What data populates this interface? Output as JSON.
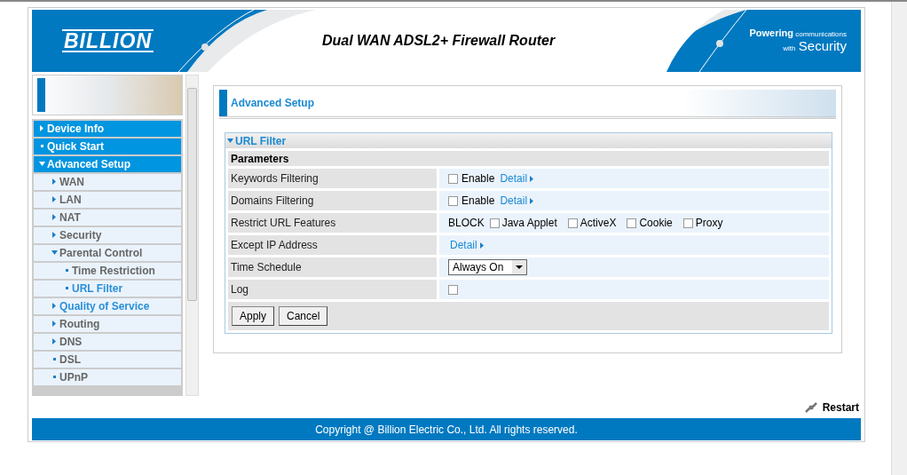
{
  "header": {
    "logo": "BILLION",
    "title": "Dual WAN ADSL2+ Firewall Router",
    "tagline_small": "Powering communications",
    "tagline_with": "with",
    "tagline_big": "Security"
  },
  "sidebar": {
    "items": [
      {
        "label": "Device Info",
        "kind": "folder",
        "expanded": false,
        "selected": false
      },
      {
        "label": "Quick Start",
        "kind": "page",
        "selected": false
      },
      {
        "label": "Advanced Setup",
        "kind": "folder",
        "expanded": true,
        "selected": false,
        "children": [
          {
            "label": "WAN",
            "kind": "folder",
            "expanded": false,
            "selected": false
          },
          {
            "label": "LAN",
            "kind": "folder",
            "expanded": false,
            "selected": false
          },
          {
            "label": "NAT",
            "kind": "folder",
            "expanded": false,
            "selected": false
          },
          {
            "label": "Security",
            "kind": "folder",
            "expanded": false,
            "selected": false
          },
          {
            "label": "Parental Control",
            "kind": "folder",
            "expanded": true,
            "selected": false,
            "children": [
              {
                "label": "Time Restriction",
                "kind": "page",
                "selected": false
              },
              {
                "label": "URL Filter",
                "kind": "page",
                "selected": true
              }
            ]
          },
          {
            "label": "Quality of Service",
            "kind": "folder",
            "expanded": false,
            "selected": true
          },
          {
            "label": "Routing",
            "kind": "folder",
            "expanded": false,
            "selected": false
          },
          {
            "label": "DNS",
            "kind": "folder",
            "expanded": false,
            "selected": false
          },
          {
            "label": "DSL",
            "kind": "page",
            "selected": false
          },
          {
            "label": "UPnP",
            "kind": "page",
            "selected": false
          }
        ]
      }
    ]
  },
  "content": {
    "title": "Advanced Setup",
    "section": {
      "title": "URL Filter",
      "expanded": true,
      "parameters_label": "Parameters",
      "rows": [
        {
          "label": "Keywords Filtering",
          "kind": "enable",
          "checked": false,
          "enable_label": "Enable",
          "link": "Detail"
        },
        {
          "label": "Domains Filtering",
          "kind": "enable",
          "checked": false,
          "enable_label": "Enable",
          "link": "Detail"
        },
        {
          "label": "Restrict URL Features",
          "kind": "features",
          "prefix": "BLOCK",
          "options": [
            {
              "label": "Java Applet",
              "checked": false
            },
            {
              "label": "ActiveX",
              "checked": false
            },
            {
              "label": "Cookie",
              "checked": false
            },
            {
              "label": "Proxy",
              "checked": false
            }
          ]
        },
        {
          "label": "Except IP Address",
          "kind": "link",
          "link": "Detail"
        },
        {
          "label": "Time Schedule",
          "kind": "select",
          "value": "Always On"
        },
        {
          "label": "Log",
          "kind": "checkbox",
          "checked": false
        }
      ],
      "buttons": [
        "Apply",
        "Cancel"
      ]
    }
  },
  "restart": "Restart",
  "footer": "Copyright @ Billion Electric Co., Ltd. All rights reserved."
}
